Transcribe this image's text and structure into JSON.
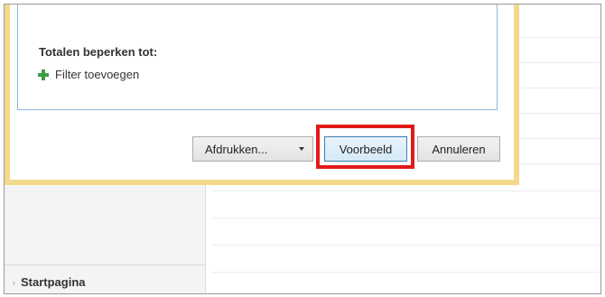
{
  "dialog": {
    "cut_text": "~ ~~~~~~~~~ ~",
    "section_title": "Totalen beperken tot:",
    "add_filter_label": "Filter toevoegen",
    "icons": {
      "add_filter": "plus-icon",
      "print_dropdown": "chevron-down-icon"
    },
    "buttons": {
      "print_label": "Afdrukken...",
      "preview_label": "Voorbeeld",
      "cancel_label": "Annuleren"
    }
  },
  "sidebar": {
    "item_label": "Startpagina"
  },
  "colors": {
    "dialog_border": "#f5d98a",
    "panel_border": "#8fb4dc",
    "highlight": "#e01b1b",
    "plus_icon": "#3d9b44"
  }
}
